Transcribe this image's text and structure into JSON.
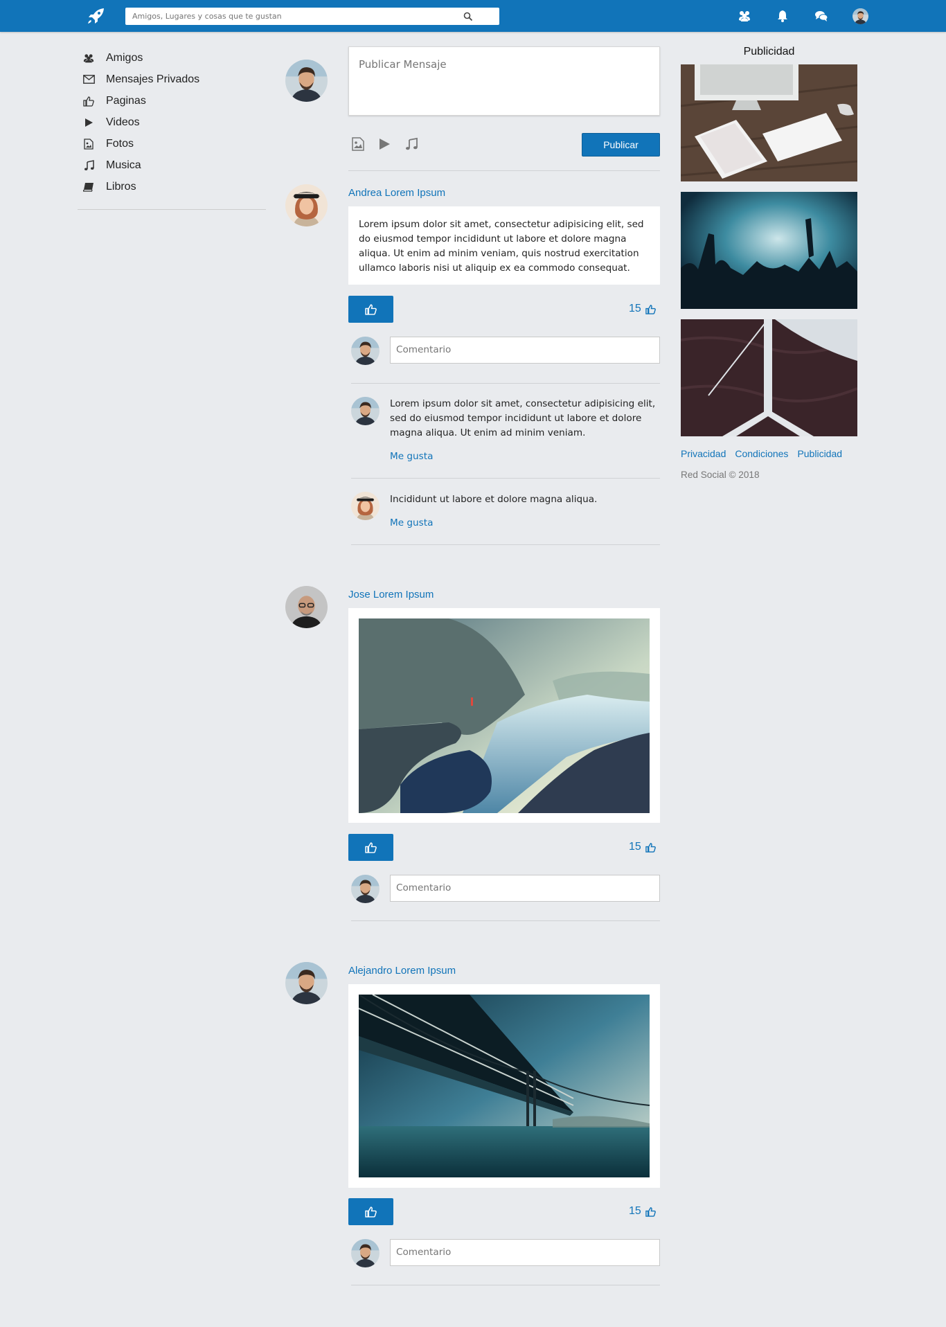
{
  "topbar": {
    "logo_icon": "rocket-icon",
    "search": {
      "placeholder": "Amigos, Lugares y cosas que te gustan",
      "value": "",
      "icon": "search-icon"
    },
    "icons": [
      "friends-icon",
      "bell-icon",
      "chat-icon"
    ],
    "brand_color": "#1174b9"
  },
  "sidebar": {
    "items": [
      {
        "label": "Amigos",
        "icon": "friends-icon"
      },
      {
        "label": "Mensajes Privados",
        "icon": "envelope-icon"
      },
      {
        "label": "Paginas",
        "icon": "thumbs-up-icon"
      },
      {
        "label": "Videos",
        "icon": "play-icon"
      },
      {
        "label": "Fotos",
        "icon": "image-file-icon"
      },
      {
        "label": "Musica",
        "icon": "music-icon"
      },
      {
        "label": "Libros",
        "icon": "book-icon"
      }
    ]
  },
  "composer": {
    "placeholder": "Publicar Mensaje",
    "media_icons": [
      "image-file-icon",
      "play-icon",
      "music-icon"
    ],
    "publish_label": "Publicar"
  },
  "posts": [
    {
      "author": "Andrea Lorem Ipsum",
      "text": "Lorem ipsum dolor sit amet, consectetur adipisicing elit, sed do eiusmod tempor incididunt ut labore et dolore magna aliqua. Ut enim ad minim veniam, quis nostrud exercitation ullamco laboris nisi ut aliquip ex ea commodo consequat.",
      "likes": "15",
      "comment_placeholder": "Comentario",
      "comments": [
        {
          "text": "Lorem ipsum dolor sit amet, consectetur adipisicing elit, sed do eiusmod tempor incididunt ut labore et dolore magna aliqua. Ut enim ad minim veniam.",
          "like_label": "Me gusta"
        },
        {
          "text": "Incididunt ut labore et dolore magna aliqua.",
          "like_label": "Me gusta"
        }
      ]
    },
    {
      "author": "Jose Lorem Ipsum",
      "likes": "15",
      "comment_placeholder": "Comentario"
    },
    {
      "author": "Alejandro Lorem Ipsum",
      "likes": "15",
      "comment_placeholder": "Comentario"
    }
  ],
  "ads": {
    "title": "Publicidad",
    "footer_links": [
      "Privacidad",
      "Condiciones",
      "Publicidad"
    ],
    "copyright": "Red Social © 2018"
  }
}
